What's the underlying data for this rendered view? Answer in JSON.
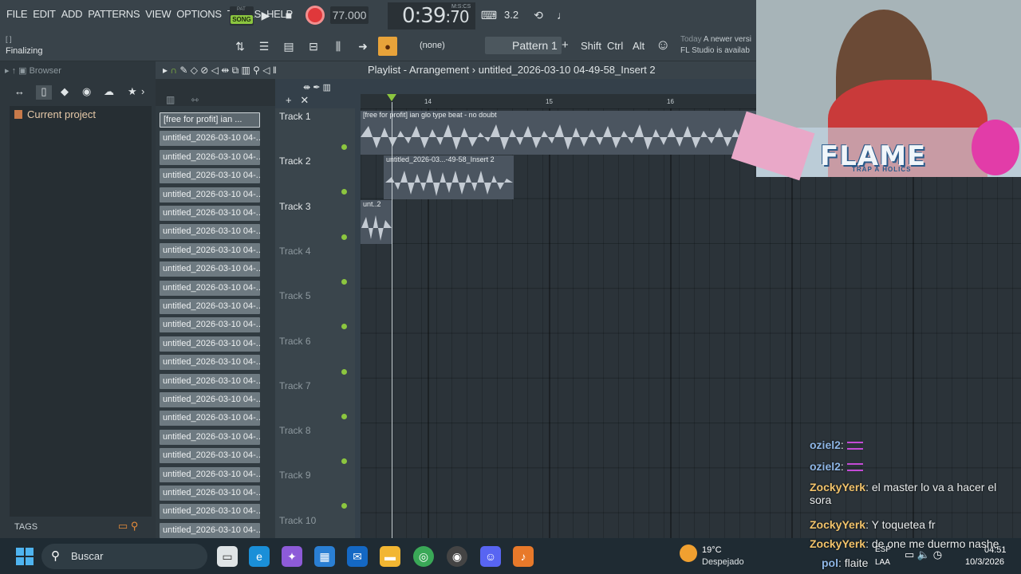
{
  "menu": [
    "FILE",
    "EDIT",
    "ADD",
    "PATTERNS",
    "VIEW",
    "OPTIONS",
    "TOOLS",
    "HELP"
  ],
  "transport": {
    "pat_label": "PAT",
    "song_label": "SONG",
    "tempo": "77.000",
    "time_main": "0:39",
    "time_sub": ":70",
    "time_unit": "M:S:CS",
    "cpu": "3.2"
  },
  "status": {
    "hint": "[ ]",
    "message": "Finalizing"
  },
  "pattern_selector": {
    "none_label": "(none)",
    "pattern_name": "Pattern 1"
  },
  "modifier_keys": [
    "Shift",
    "Ctrl",
    "Alt"
  ],
  "news": {
    "line1_gray": "Today",
    "line1": "A newer versi",
    "line2": "FL Studio is availab"
  },
  "browser": {
    "title": "Browser",
    "current_project": "Current project",
    "tags_label": "TAGS"
  },
  "playlist": {
    "title": "Playlist - Arrangement",
    "project": "untitled_2026-03-10 04-49-58_Insert 2",
    "ruler": [
      "14",
      "15",
      "16"
    ]
  },
  "clip_list": [
    "[free for profit] ian ...",
    "untitled_2026-03-10 04-...",
    "untitled_2026-03-10 04-...",
    "untitled_2026-03-10 04-...",
    "untitled_2026-03-10 04-...",
    "untitled_2026-03-10 04-...",
    "untitled_2026-03-10 04-...",
    "untitled_2026-03-10 04-...",
    "untitled_2026-03-10 04-...",
    "untitled_2026-03-10 04-...",
    "untitled_2026-03-10 04-...",
    "untitled_2026-03-10 04-...",
    "untitled_2026-03-10 04-...",
    "untitled_2026-03-10 04-...",
    "untitled_2026-03-10 04-...",
    "untitled_2026-03-10 04-...",
    "untitled_2026-03-10 04-...",
    "untitled_2026-03-10 04-...",
    "untitled_2026-03-10 04-...",
    "untitled_2026-03-10 04-...",
    "untitled_2026-03-10 04-...",
    "untitled_2026-03-10 04-...",
    "untitled_2026-03-10 04-..."
  ],
  "tracks": [
    "Track 1",
    "Track 2",
    "Track 3",
    "Track 4",
    "Track 5",
    "Track 6",
    "Track 7",
    "Track 8",
    "Track 9",
    "Track 10"
  ],
  "audio_clips": [
    {
      "label": "[free for profit] ian  glo type beat - no doubt"
    },
    {
      "label": "untitled_2026-03...-49-58_Insert 2"
    },
    {
      "label": "unt..2"
    }
  ],
  "overlay": {
    "flame": "FLAME",
    "flame_sub": "TRAP A HOLICS"
  },
  "chat": [
    {
      "user": "oziel2",
      "text": ""
    },
    {
      "user": "oziel2",
      "text": ""
    },
    {
      "user": "ZockyYerk",
      "text": "el master lo va a hacer el sora"
    },
    {
      "user": "ZockyYerk",
      "text": "Y toquetea fr"
    },
    {
      "user": "ZockyYerk",
      "text": "de one me duermo nashe"
    },
    {
      "user": "pol",
      "text": "flaite"
    }
  ],
  "taskbar": {
    "search_placeholder": "Buscar",
    "weather_temp": "19°C",
    "weather_desc": "Despejado",
    "lang1": "ESP",
    "lang2": "LAA",
    "time": "04:51",
    "date": "10/3/2026"
  },
  "colors": {
    "song_accent": "#8cc63f",
    "record": "#e0383b",
    "chat_user_blue": "#8eb6e6",
    "chat_user_gold": "#f2c36b"
  }
}
